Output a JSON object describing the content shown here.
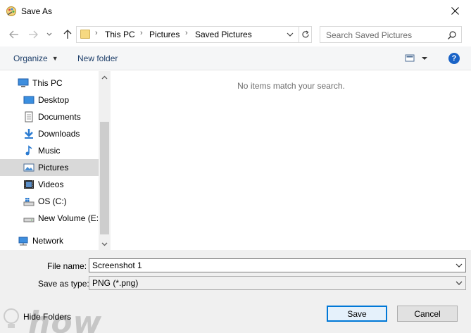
{
  "window": {
    "title": "Save As"
  },
  "address": {
    "crumbs": [
      "This PC",
      "Pictures",
      "Saved Pictures"
    ]
  },
  "search": {
    "placeholder": "Search Saved Pictures"
  },
  "toolbar": {
    "organize": "Organize",
    "new_folder": "New folder",
    "help": "?"
  },
  "sidebar": {
    "items": [
      {
        "label": "This PC",
        "icon": "computer-icon"
      },
      {
        "label": "Desktop",
        "icon": "desktop-icon"
      },
      {
        "label": "Documents",
        "icon": "documents-icon"
      },
      {
        "label": "Downloads",
        "icon": "downloads-icon"
      },
      {
        "label": "Music",
        "icon": "music-icon"
      },
      {
        "label": "Pictures",
        "icon": "pictures-icon",
        "selected": true
      },
      {
        "label": "Videos",
        "icon": "videos-icon"
      },
      {
        "label": "OS (C:)",
        "icon": "drive-icon"
      },
      {
        "label": "New Volume (E:)",
        "icon": "drive-icon"
      },
      {
        "label": "Network",
        "icon": "network-icon"
      }
    ]
  },
  "content": {
    "empty_message": "No items match your search."
  },
  "form": {
    "file_name_label": "File name:",
    "file_name_value": "Screenshot 1",
    "save_type_label": "Save as type:",
    "save_type_value": "PNG (*.png)"
  },
  "footer": {
    "hide_folders": "Hide Folders",
    "save": "Save",
    "cancel": "Cancel",
    "watermark": "how"
  },
  "colors": {
    "accent": "#0078d7",
    "link": "#1e3f6a",
    "selected": "#d9d9d9"
  }
}
